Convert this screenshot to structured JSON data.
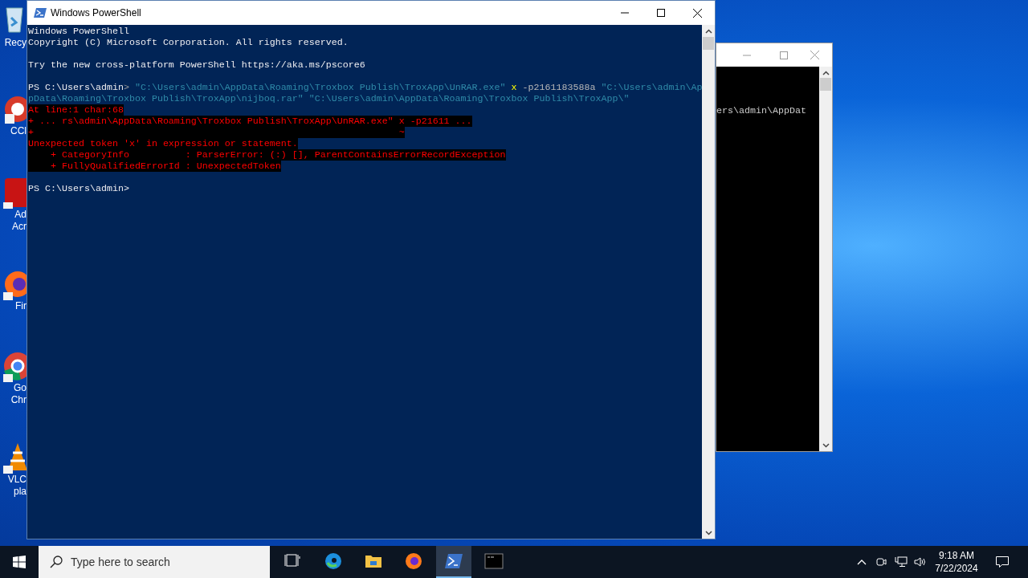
{
  "desktop_icons": [
    {
      "kind": "bin",
      "lines": [
        "Recy"
      ]
    },
    {
      "kind": "ccleaner",
      "lines": [
        "CCl"
      ]
    },
    {
      "kind": "acrobat",
      "lines": [
        "Ad",
        "Acr"
      ]
    },
    {
      "kind": "firefox",
      "lines": [
        "Fir"
      ]
    },
    {
      "kind": "chrome",
      "lines": [
        "Go",
        "Chr"
      ]
    },
    {
      "kind": "vlc",
      "lines": [
        "VLC",
        "pla"
      ]
    }
  ],
  "back_window": {
    "console_lines": [
      "ers\\admin\\AppDat"
    ]
  },
  "window": {
    "title": "Windows PowerShell",
    "console_blocks": [
      [
        [
          {
            "kind": "text",
            "text": "Windows PowerShell"
          }
        ],
        [
          {
            "kind": "text",
            "text": "Copyright (C) Microsoft Corporation. All rights reserved."
          }
        ]
      ],
      [
        [
          {
            "kind": "text",
            "text": "Try the new cross-platform PowerShell https://aka.ms/pscore6"
          }
        ]
      ],
      [
        [
          {
            "kind": "text",
            "text": "PS C:\\Users\\admin"
          },
          {
            "kind": "operator",
            "text": "> "
          },
          {
            "kind": "string",
            "text": "\"C:\\Users\\admin\\AppData\\Roaming\\Troxbox Publish\\TroxApp\\UnRAR.exe\" "
          },
          {
            "kind": "command",
            "text": "x"
          },
          {
            "kind": "argument",
            "text": " -p2161183588a "
          },
          {
            "kind": "string",
            "text": "\"C:\\Users\\admin\\Ap"
          }
        ],
        [
          {
            "kind": "string",
            "text": "pData\\Roaming\\Troxbox Publish\\TroxApp\\nijboq.rar\" \"C:\\Users\\admin\\AppData\\Roaming\\Troxbox Publish\\TroxApp\\\""
          }
        ],
        [
          {
            "kind": "error",
            "text": "At line:1 char:68"
          }
        ],
        [
          {
            "kind": "error",
            "text": "+ ... rs\\admin\\AppData\\Roaming\\Troxbox Publish\\TroxApp\\UnRAR.exe\" x -p21611 ..."
          }
        ],
        [
          {
            "kind": "error",
            "text": "+                                                                 ~"
          }
        ],
        [
          {
            "kind": "error",
            "text": "Unexpected token 'x' in expression or statement."
          }
        ],
        [
          {
            "kind": "error",
            "text": "    + CategoryInfo          : ParserError: (:) [], ParentContainsErrorRecordException"
          }
        ],
        [
          {
            "kind": "error",
            "text": "    + FullyQualifiedErrorId : UnexpectedToken"
          }
        ]
      ],
      [
        [
          {
            "kind": "text",
            "text": "PS C:\\Users\\admin>"
          }
        ]
      ]
    ]
  },
  "taskbar": {
    "search": {
      "placeholder": "Type here to search"
    },
    "apps": [
      {
        "kind": "taskview",
        "selected": false
      },
      {
        "kind": "edge",
        "selected": false
      },
      {
        "kind": "explorer",
        "selected": false
      },
      {
        "kind": "firefox",
        "selected": false
      },
      {
        "kind": "powershell",
        "selected": true
      },
      {
        "kind": "cmd",
        "selected": false
      }
    ],
    "time": "9:18 AM",
    "date": "7/22/2024"
  }
}
